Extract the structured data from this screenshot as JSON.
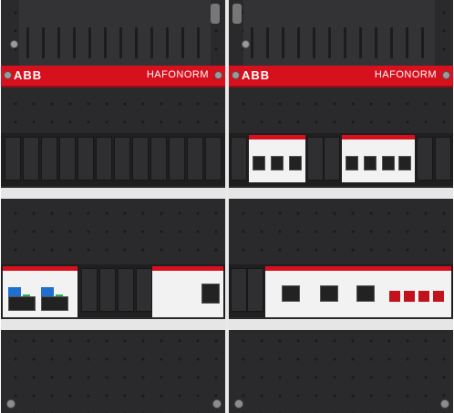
{
  "panels": [
    {
      "logo": "ABB",
      "brand": "HAFONORM"
    },
    {
      "logo": "ABB",
      "brand": "HAFONORM"
    }
  ],
  "colors": {
    "panel": "#2a2a2c",
    "red_strip": "#d7101d",
    "device_body": "#f2f2f2",
    "blue_lever": "#1e6fd0",
    "green_lever": "#2bb34a"
  }
}
